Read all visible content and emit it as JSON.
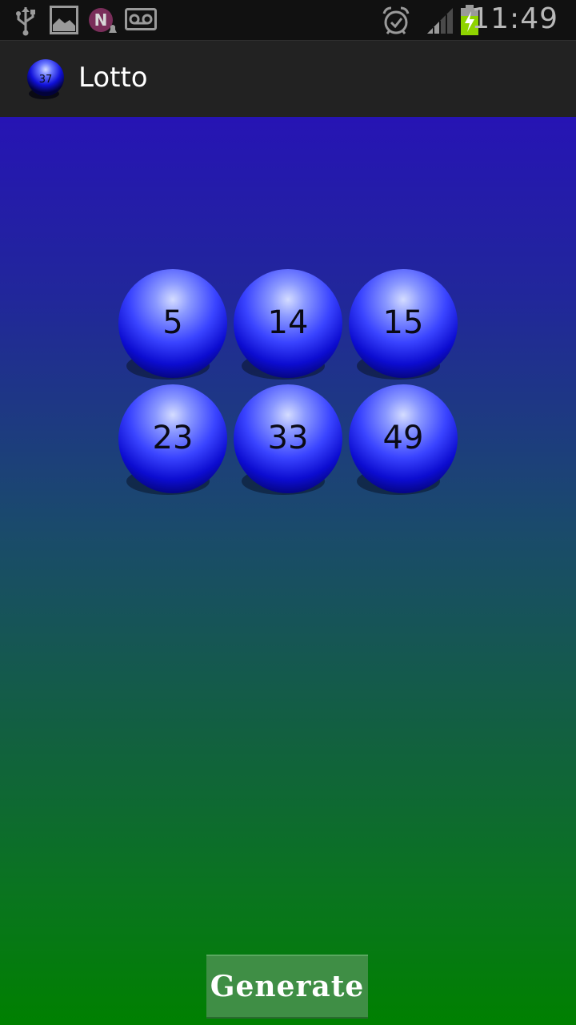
{
  "status_bar": {
    "time": "11:49",
    "icons": [
      "usb-icon",
      "gallery-icon",
      "notification-app-icon",
      "voicemail-icon",
      "alarm-icon",
      "signal-icon",
      "battery-charging-icon"
    ],
    "battery_color": "#8fd400"
  },
  "app_bar": {
    "title": "Lotto",
    "icon_number": "37"
  },
  "lotto": {
    "numbers": [
      "5",
      "14",
      "15",
      "23",
      "33",
      "49"
    ],
    "ball_color": "#1a1aff"
  },
  "generate_button": {
    "label": "Generate",
    "color": "#3f8e45"
  },
  "colors": {
    "gradient_top": "#2614b4",
    "gradient_bottom": "#008000"
  }
}
